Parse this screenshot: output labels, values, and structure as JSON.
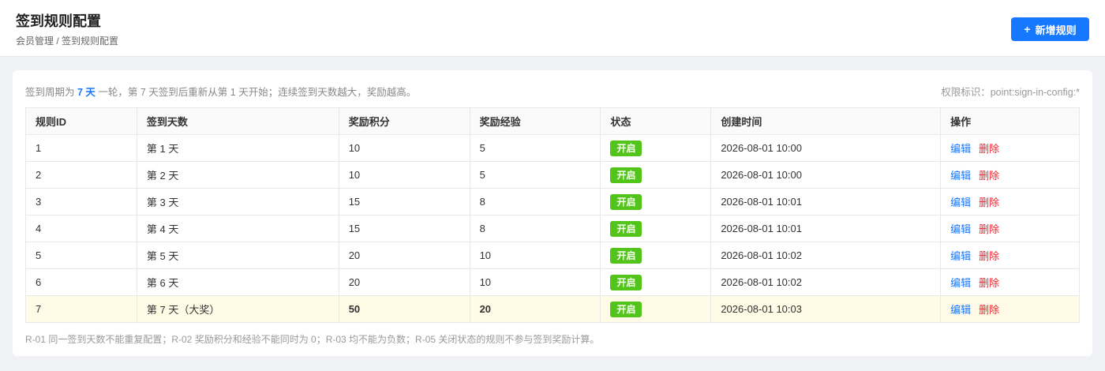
{
  "header": {
    "title": "签到规则配置",
    "breadcrumb": "会员管理 / 签到规则配置",
    "add_button_icon": "+",
    "add_button_label": "新增规则"
  },
  "info": {
    "prefix": "签到周期为 ",
    "cycle": "7 天",
    "suffix": " 一轮，第 7 天签到后重新从第 1 天开始；连续签到天数越大，奖励越高。",
    "permission": "权限标识：point:sign-in-config:*"
  },
  "table": {
    "headers": [
      "规则ID",
      "签到天数",
      "奖励积分",
      "奖励经验",
      "状态",
      "创建时间",
      "操作"
    ],
    "rows": [
      {
        "id": "1",
        "day": "第 1 天",
        "points": "10",
        "exp": "5",
        "status": "开启",
        "created": "2026-08-01 10:00",
        "edit": "编辑",
        "delete": "删除"
      },
      {
        "id": "2",
        "day": "第 2 天",
        "points": "10",
        "exp": "5",
        "status": "开启",
        "created": "2026-08-01 10:00",
        "edit": "编辑",
        "delete": "删除"
      },
      {
        "id": "3",
        "day": "第 3 天",
        "points": "15",
        "exp": "8",
        "status": "开启",
        "created": "2026-08-01 10:01",
        "edit": "编辑",
        "delete": "删除"
      },
      {
        "id": "4",
        "day": "第 4 天",
        "points": "15",
        "exp": "8",
        "status": "开启",
        "created": "2026-08-01 10:01",
        "edit": "编辑",
        "delete": "删除"
      },
      {
        "id": "5",
        "day": "第 5 天",
        "points": "20",
        "exp": "10",
        "status": "开启",
        "created": "2026-08-01 10:02",
        "edit": "编辑",
        "delete": "删除"
      },
      {
        "id": "6",
        "day": "第 6 天",
        "points": "20",
        "exp": "10",
        "status": "开启",
        "created": "2026-08-01 10:02",
        "edit": "编辑",
        "delete": "删除"
      },
      {
        "id": "7",
        "day": "第 7 天（大奖）",
        "points": "50",
        "exp": "20",
        "status": "开启",
        "created": "2026-08-01 10:03",
        "edit": "编辑",
        "delete": "删除"
      }
    ]
  },
  "footnote": "R-01 同一签到天数不能重复配置；R-02 奖励积分和经验不能同时为 0；R-03 均不能为负数；R-05 关闭状态的规则不参与签到奖励计算。",
  "colors": {
    "primary": "#1677ff",
    "status_on": "#52c41a",
    "danger": "#f5222d",
    "highlight_row": "#fffbe6"
  }
}
